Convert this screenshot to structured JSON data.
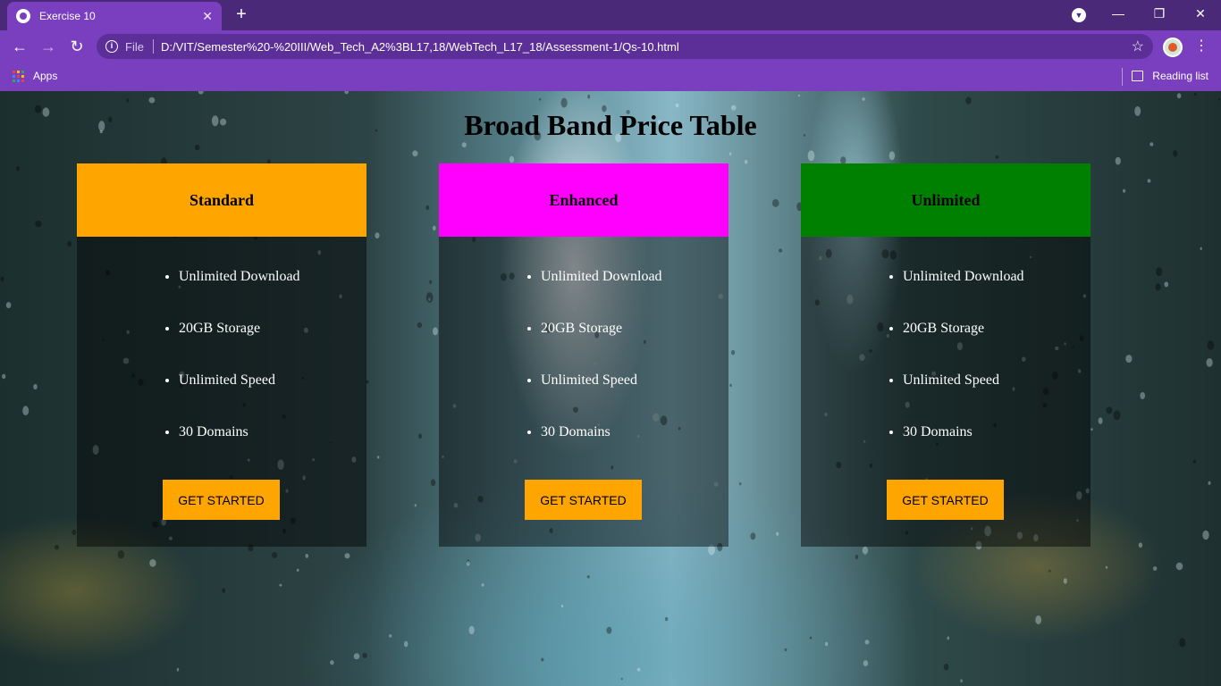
{
  "browser": {
    "tab_title": "Exercise 10",
    "address_scheme": "File",
    "address_url": "D:/VIT/Semester%20-%20III/Web_Tech_A2%3BL17,18/WebTech_L17_18/Assessment-1/Qs-10.html",
    "bookmark_apps": "Apps",
    "bookmark_reading_list": "Reading list"
  },
  "page": {
    "title": "Broad Band Price Table",
    "plans": [
      {
        "name": "Standard",
        "header_color": "#ffa500",
        "features": [
          "Unlimited Download",
          "20GB Storage",
          "Unlimited Speed",
          "30 Domains"
        ],
        "button_label": "GET STARTED"
      },
      {
        "name": "Enhanced",
        "header_color": "#ff00ff",
        "features": [
          "Unlimited Download",
          "20GB Storage",
          "Unlimited Speed",
          "30 Domains"
        ],
        "button_label": "GET STARTED"
      },
      {
        "name": "Unlimited",
        "header_color": "#008000",
        "features": [
          "Unlimited Download",
          "20GB Storage",
          "Unlimited Speed",
          "30 Domains"
        ],
        "button_label": "GET STARTED"
      }
    ],
    "button_color": "#ffa500"
  }
}
